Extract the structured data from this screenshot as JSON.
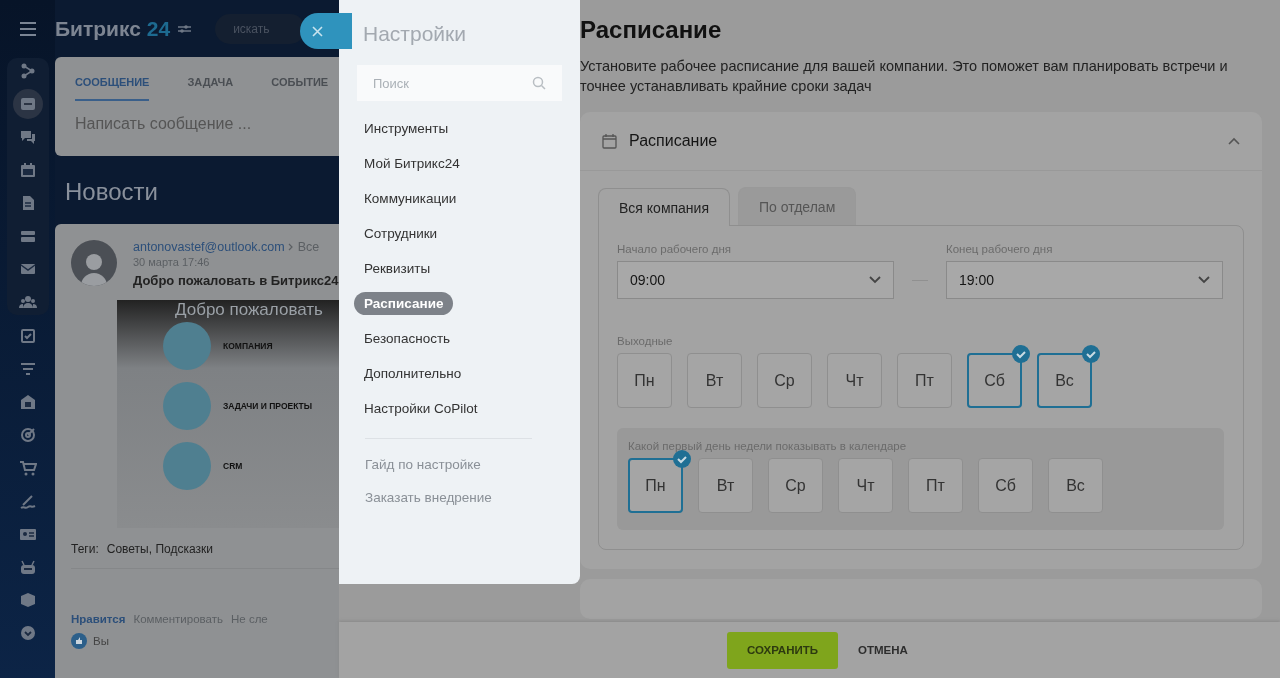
{
  "header": {
    "logo_text": "Битрикс",
    "logo_number": "24",
    "search_placeholder": "искать"
  },
  "composer": {
    "tabs": [
      {
        "label": "СООБЩЕНИЕ",
        "selected": true
      },
      {
        "label": "ЗАДАЧА",
        "selected": false
      },
      {
        "label": "СОБЫТИЕ",
        "selected": false
      }
    ],
    "placeholder": "Написать сообщение ..."
  },
  "feed": {
    "title": "Новости",
    "post": {
      "author": "antonovastef@outlook.com",
      "recipient": "Все",
      "date": "30 марта 17:46",
      "title": "Добро пожаловать в Битрикс24",
      "image": {
        "overlay_text": "Добро пожаловать",
        "steps": [
          "КОМПАНИЯ",
          "ЗАДАЧИ И ПРОЕКТЫ",
          "CRM"
        ]
      },
      "tags_label": "Теги:",
      "tags": "Советы, Подсказки",
      "actions": [
        {
          "label": "Нравится",
          "kind": "like"
        },
        {
          "label": "Комментировать",
          "kind": "plain"
        },
        {
          "label": "Не сле",
          "kind": "plain"
        }
      ],
      "likes": "Вы"
    }
  },
  "settings_menu": {
    "title": "Настройки",
    "search_placeholder": "Поиск",
    "items": [
      {
        "label": "Инструменты",
        "selected": false
      },
      {
        "label": "Мой Битрикс24",
        "selected": false
      },
      {
        "label": "Коммуникации",
        "selected": false
      },
      {
        "label": "Сотрудники",
        "selected": false
      },
      {
        "label": "Реквизиты",
        "selected": false
      },
      {
        "label": "Расписание",
        "selected": true
      },
      {
        "label": "Безопасность",
        "selected": false
      },
      {
        "label": "Дополнительно",
        "selected": false
      },
      {
        "label": "Настройки CoPilot",
        "selected": false
      }
    ],
    "links": [
      "Гайд по настройке",
      "Заказать внедрение"
    ]
  },
  "schedule": {
    "title": "Расписание",
    "description": "Установите рабочее расписание для вашей компании. Это поможет вам планировать встречи и точнее устанавливать крайние сроки задач",
    "card": {
      "title": "Расписание",
      "expanded": true
    },
    "tabs": [
      {
        "label": "Вся компания",
        "selected": true
      },
      {
        "label": "По отделам",
        "selected": false
      }
    ],
    "start_label": "Начало рабочего дня",
    "start_value": "09:00",
    "end_label": "Конец рабочего дня",
    "end_value": "19:00",
    "weekends_label": "Выходные",
    "weekend_days": [
      {
        "label": "Пн",
        "selected": false
      },
      {
        "label": "Вт",
        "selected": false
      },
      {
        "label": "Ср",
        "selected": false
      },
      {
        "label": "Чт",
        "selected": false
      },
      {
        "label": "Пт",
        "selected": false
      },
      {
        "label": "Сб",
        "selected": true
      },
      {
        "label": "Вс",
        "selected": true
      }
    ],
    "first_day_label": "Какой первый день недели показывать в календаре",
    "first_day_options": [
      {
        "label": "Пн",
        "selected": true
      },
      {
        "label": "Вт",
        "selected": false
      },
      {
        "label": "Ср",
        "selected": false
      },
      {
        "label": "Чт",
        "selected": false
      },
      {
        "label": "Пт",
        "selected": false
      },
      {
        "label": "Сб",
        "selected": false
      },
      {
        "label": "Вс",
        "selected": false
      }
    ]
  },
  "footer": {
    "buttons": [
      {
        "label": "СОХРАНИТЬ",
        "kind": "primary"
      },
      {
        "label": "ОТМЕНА",
        "kind": "link"
      }
    ]
  }
}
